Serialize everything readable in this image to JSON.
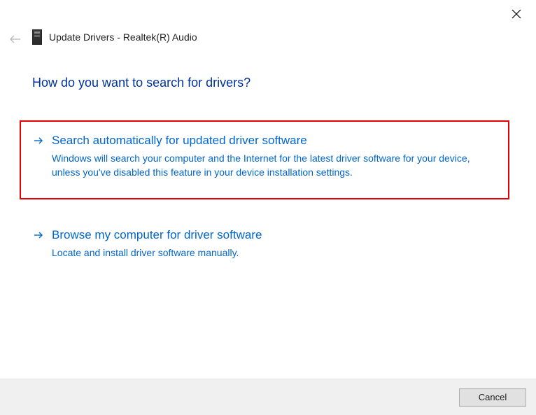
{
  "window": {
    "title": "Update Drivers - Realtek(R) Audio"
  },
  "heading": "How do you want to search for drivers?",
  "options": [
    {
      "title": "Search automatically for updated driver software",
      "description": "Windows will search your computer and the Internet for the latest driver software for your device, unless you've disabled this feature in your device installation settings.",
      "highlighted": true
    },
    {
      "title": "Browse my computer for driver software",
      "description": "Locate and install driver software manually.",
      "highlighted": false
    }
  ],
  "footer": {
    "cancel_label": "Cancel"
  }
}
